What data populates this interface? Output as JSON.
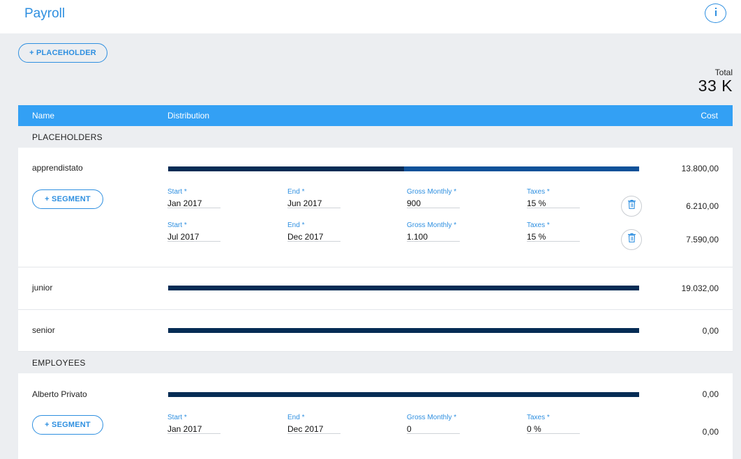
{
  "header": {
    "title": "Payroll",
    "info_icon": "info-icon"
  },
  "actions": {
    "add_placeholder": "+ PLACEHOLDER"
  },
  "total": {
    "label": "Total",
    "value": "33 K"
  },
  "table": {
    "columns": {
      "name": "Name",
      "distribution": "Distribution",
      "cost": "Cost"
    }
  },
  "groups": {
    "placeholders": {
      "title": "PLACEHOLDERS",
      "rows": [
        {
          "name": "apprendistato",
          "cost": "13.800,00",
          "distribution": [
            0.5,
            0.5
          ],
          "add_segment": "+ SEGMENT",
          "segments": [
            {
              "start_label": "Start *",
              "start": "Jan 2017",
              "end_label": "End *",
              "end": "Jun 2017",
              "gross_label": "Gross Monthly *",
              "gross": "900",
              "taxes_label": "Taxes *",
              "taxes": "15 %",
              "cost": "6.210,00"
            },
            {
              "start_label": "Start *",
              "start": "Jul 2017",
              "end_label": "End *",
              "end": "Dec 2017",
              "gross_label": "Gross Monthly *",
              "gross": "1.100",
              "taxes_label": "Taxes *",
              "taxes": "15 %",
              "cost": "7.590,00"
            }
          ]
        },
        {
          "name": "junior",
          "cost": "19.032,00",
          "distribution": [
            1
          ]
        },
        {
          "name": "senior",
          "cost": "0,00",
          "distribution": [
            1
          ]
        }
      ]
    },
    "employees": {
      "title": "EMPLOYEES",
      "rows": [
        {
          "name": "Alberto Privato",
          "cost": "0,00",
          "distribution": [
            1
          ],
          "add_segment": "+ SEGMENT",
          "segments": [
            {
              "start_label": "Start *",
              "start": "Jan 2017",
              "end_label": "End *",
              "end": "Dec 2017",
              "gross_label": "Gross Monthly *",
              "gross": "0",
              "taxes_label": "Taxes *",
              "taxes": "0 %",
              "cost": "0,00"
            }
          ]
        }
      ]
    }
  },
  "colors": {
    "accent": "#2e8fe0",
    "header_bar": "#33a0f4",
    "bar_dark": "#062c55",
    "bar_mid": "#0e5199",
    "background": "#eceef1"
  }
}
